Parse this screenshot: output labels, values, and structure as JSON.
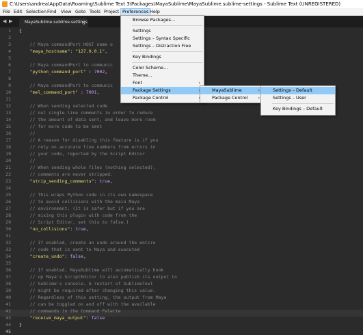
{
  "window": {
    "title": "C:\\Users\\andrea\\AppData\\Roaming\\Sublime Text 3\\Packages\\MayaSublime\\MayaSublime.sublime-settings - Sublime Text (UNREGISTERED)"
  },
  "menubar": [
    "File",
    "Edit",
    "Selection",
    "Find",
    "View",
    "Goto",
    "Tools",
    "Project",
    "Preferences",
    "Help"
  ],
  "tabs": {
    "nav_left": "◀",
    "nav_right": "▶",
    "active_tab": "MayaSublime.sublime-settings",
    "close": "×"
  },
  "line_numbers": [
    "1",
    "2",
    "3",
    "4",
    "5",
    "6",
    "7",
    "8",
    "9",
    "10",
    "11",
    "12",
    "13",
    "14",
    "15",
    "16",
    "17",
    "18",
    "19",
    "20",
    "21",
    "22",
    "23",
    "24",
    "25",
    "26",
    "27",
    "28",
    "29",
    "30",
    "31",
    "32",
    "33",
    "34",
    "35",
    "36",
    "37",
    "38",
    "39",
    "40",
    "41",
    "42",
    "43",
    "44",
    "45"
  ],
  "code": {
    "l1": "{",
    "l3": "    // Maya commandPort HOST name o",
    "l4_key": "    \"maya_hostname\"",
    "l4_colon": ": ",
    "l4_val": "\"127.0.0.1\"",
    "l4_end": ",",
    "l6": "    // Maya commandPort to communic",
    "l7_key": "    \"python_command_port\"",
    "l7_colon": " : ",
    "l7_val": "7002",
    "l7_end": ",",
    "l9": "    // Maya commandPort to communic",
    "l10_key": "    \"mel_command_port\"",
    "l10_colon": " : ",
    "l10_val": "7001",
    "l10_end": ",",
    "l12": "    // When sending selected code",
    "l13": "    // out single-line comments in order to reduce",
    "l14": "    // the amount of data sent, and leave more room",
    "l15": "    // for more code to be sent",
    "l16": "    //",
    "l17": "    // A reason for disabling this feature is if you",
    "l18": "    // rely on accurate line numbers from errors in",
    "l19": "    // your code, reported by the Script Editor",
    "l20": "    //",
    "l21": "    // When sending whole files (nothing selected),",
    "l22": "    // comments are never stripped.",
    "l23_key": "    \"strip_sending_comments\"",
    "l23_colon": ": ",
    "l23_val": "true",
    "l23_end": ",",
    "l25": "    // This wraps Python code in its own namespace",
    "l26": "    // to avoid collisions with the main Maya",
    "l27": "    // environment. (It is safer but if you are",
    "l28": "    // mixing this plugin with code from the",
    "l29": "    // Script Editor, set this to false.)",
    "l30_key": "    \"no_collisions\"",
    "l30_colon": ": ",
    "l30_val": "true",
    "l30_end": ",",
    "l32": "    // If enabled, create an undo around the entire",
    "l33": "    // code that is sent to Maya and executed",
    "l34_key": "    \"create_undo\"",
    "l34_colon": ": ",
    "l34_val": "false",
    "l34_end": ",",
    "l36": "    // If enabled, MayaSublime will automatically hook",
    "l37": "    // up Maya's ScriptEditor to also publish its output to",
    "l38": "    // Sublime's console. A restart of SublimeText",
    "l39": "    // might be required after changing this value.",
    "l40": "    // Regardless of this setting, the output from Maya",
    "l41": "    // can be toggled on and off with the available",
    "l42": "    // commands in the Command Palette",
    "l43_key": "    \"receive_maya_output\"",
    "l43_colon": ": ",
    "l43_val": "false",
    "l44": "}"
  },
  "preferences_menu": {
    "browse_packages": "Browse Packages...",
    "settings": "Settings",
    "settings_syntax": "Settings – Syntax Specific",
    "settings_distraction": "Settings – Distraction Free",
    "key_bindings": "Key Bindings",
    "color_scheme": "Color Scheme...",
    "theme": "Theme...",
    "font": "Font",
    "package_settings": "Package Settings",
    "package_control": "Package Control"
  },
  "package_settings_menu": {
    "mayasublime": "MayaSublime",
    "package_control": "Package Control"
  },
  "mayasublime_menu": {
    "settings_default": "Settings – Default",
    "settings_user": "Settings – User",
    "key_bindings_default": "Key Bindings – Default"
  },
  "submenu_arrow": "›"
}
